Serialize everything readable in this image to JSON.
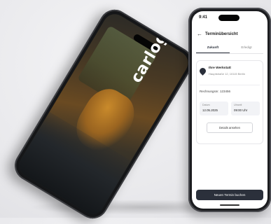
{
  "left_phone": {
    "logo": "carlog",
    "logo_color": "#ffffff"
  },
  "right_phone": {
    "status_time": "9:41",
    "header": {
      "title": "Terminübersicht",
      "back_icon": "arrow-left-icon"
    },
    "tabs": [
      {
        "label": "Zukunft",
        "active": true
      },
      {
        "label": "Erledigt",
        "active": false
      }
    ],
    "appointment": {
      "location_icon": "map-pin-icon",
      "location_name": "Ihre Werkstatt",
      "location_address": "Hauptstraße 12, 10115 Berlin",
      "reference": "Rechnungsnr. 123456",
      "dates": [
        {
          "label": "Datum",
          "value": "12.05.2025"
        },
        {
          "label": "Uhrzeit",
          "value": "09:00 Uhr"
        }
      ],
      "details_button": "Details ansehen"
    },
    "book_button": "Neuen Termin buchen",
    "accent_color": "#2b303b"
  }
}
